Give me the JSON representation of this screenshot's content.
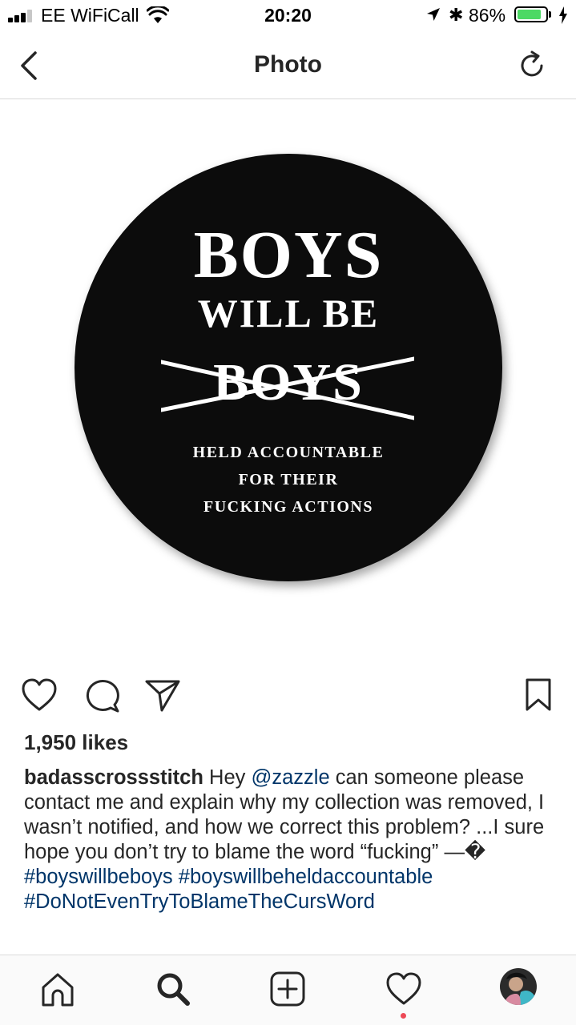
{
  "status_bar": {
    "carrier": "EE WiFiCall",
    "time": "20:20",
    "battery_percent": "86%",
    "battery_level": 0.86,
    "icons": [
      "signal-icon",
      "wifi-icon",
      "location-arrow-icon",
      "bluetooth-icon",
      "battery-icon",
      "charging-icon"
    ]
  },
  "nav": {
    "title": "Photo",
    "back_icon": "chevron-left-icon",
    "refresh_icon": "refresh-icon"
  },
  "photo": {
    "line1": "BOYS",
    "line2": "WILL BE",
    "line3": "BOYS",
    "line4": "HELD ACCOUNTABLE",
    "line5": "FOR THEIR",
    "line6": "FUCKING ACTIONS"
  },
  "actions": {
    "icons": [
      "heart-icon",
      "comment-icon",
      "share-icon",
      "bookmark-icon"
    ]
  },
  "likes": "1,950 likes",
  "caption": {
    "username": "badasscrossstitch",
    "text_before_mention": " Hey ",
    "mention": "@zazzle",
    "text_after_mention": " can someone please contact me and explain why my collection was removed, I wasn’t notified, and how we correct this problem? ...I sure hope you don’t try to blame the word “fucking” —",
    "trailing_glyph": "�",
    "hashtags": [
      "#boyswillbeboys",
      "#boyswillbeheldaccountable",
      "#DoNotEvenTryToBlameTheCursWord"
    ]
  },
  "tab_bar": {
    "icons": [
      "home-icon",
      "search-icon",
      "add-post-icon",
      "activity-heart-icon",
      "profile-avatar"
    ],
    "activity_dot_color": "#ed4956"
  }
}
